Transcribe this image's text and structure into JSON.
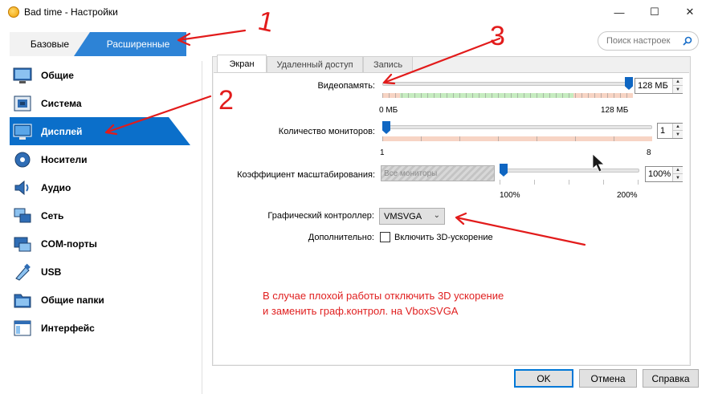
{
  "window": {
    "title": "Bad time - Настройки",
    "minimize_glyph": "—",
    "maximize_glyph": "☐",
    "close_glyph": "✕"
  },
  "mode_tabs": {
    "basic": "Базовые",
    "advanced": "Расширенные",
    "active": "advanced"
  },
  "search": {
    "placeholder": "Поиск настроек",
    "value": ""
  },
  "sidebar": {
    "active": "Дисплей",
    "items": [
      {
        "label": "Общие",
        "icon": "general-icon"
      },
      {
        "label": "Система",
        "icon": "system-icon"
      },
      {
        "label": "Дисплей",
        "icon": "display-icon"
      },
      {
        "label": "Носители",
        "icon": "storage-icon"
      },
      {
        "label": "Аудио",
        "icon": "audio-icon"
      },
      {
        "label": "Сеть",
        "icon": "network-icon"
      },
      {
        "label": "COM-порты",
        "icon": "serial-ports-icon"
      },
      {
        "label": "USB",
        "icon": "usb-icon"
      },
      {
        "label": "Общие папки",
        "icon": "shared-folders-icon"
      },
      {
        "label": "Интерфейс",
        "icon": "user-interface-icon"
      }
    ]
  },
  "display_tabs": {
    "items": [
      "Экран",
      "Удаленный доступ",
      "Запись"
    ],
    "active": "Экран"
  },
  "video_memory": {
    "label": "Видеопамять:",
    "value": "128 МБ",
    "min_label": "0 МБ",
    "max_label": "128 МБ",
    "fraction": 1.0
  },
  "monitors": {
    "label": "Количество мониторов:",
    "value": "1",
    "min_label": "1",
    "max_label": "8",
    "fraction": 0.0
  },
  "scale": {
    "label": "Коэффициент масштабирования:",
    "combo_value": "Все мониторы",
    "value": "100%",
    "min_label": "100%",
    "max_label": "200%",
    "fraction": 0.0
  },
  "graphics_controller": {
    "label": "Графический контроллер:",
    "value": "VMSVGA"
  },
  "extended": {
    "label": "Дополнительно:",
    "checkbox_label": "Включить 3D-ускорение",
    "checked": false
  },
  "annotation": {
    "color": "#e02020",
    "note_line1": "В случае плохой работы отключить 3D ускорение",
    "note_line2": "и заменить граф.контрол. на VboxSVGA",
    "marks": [
      "1",
      "3",
      "2"
    ]
  },
  "buttons": {
    "ok": "OK",
    "cancel": "Отмена",
    "help": "Справка"
  },
  "colors": {
    "accent": "#0b6fca",
    "tab_active": "#2d83d6",
    "zone_green": "#c6ecc0",
    "zone_red": "#f7d4c4"
  }
}
